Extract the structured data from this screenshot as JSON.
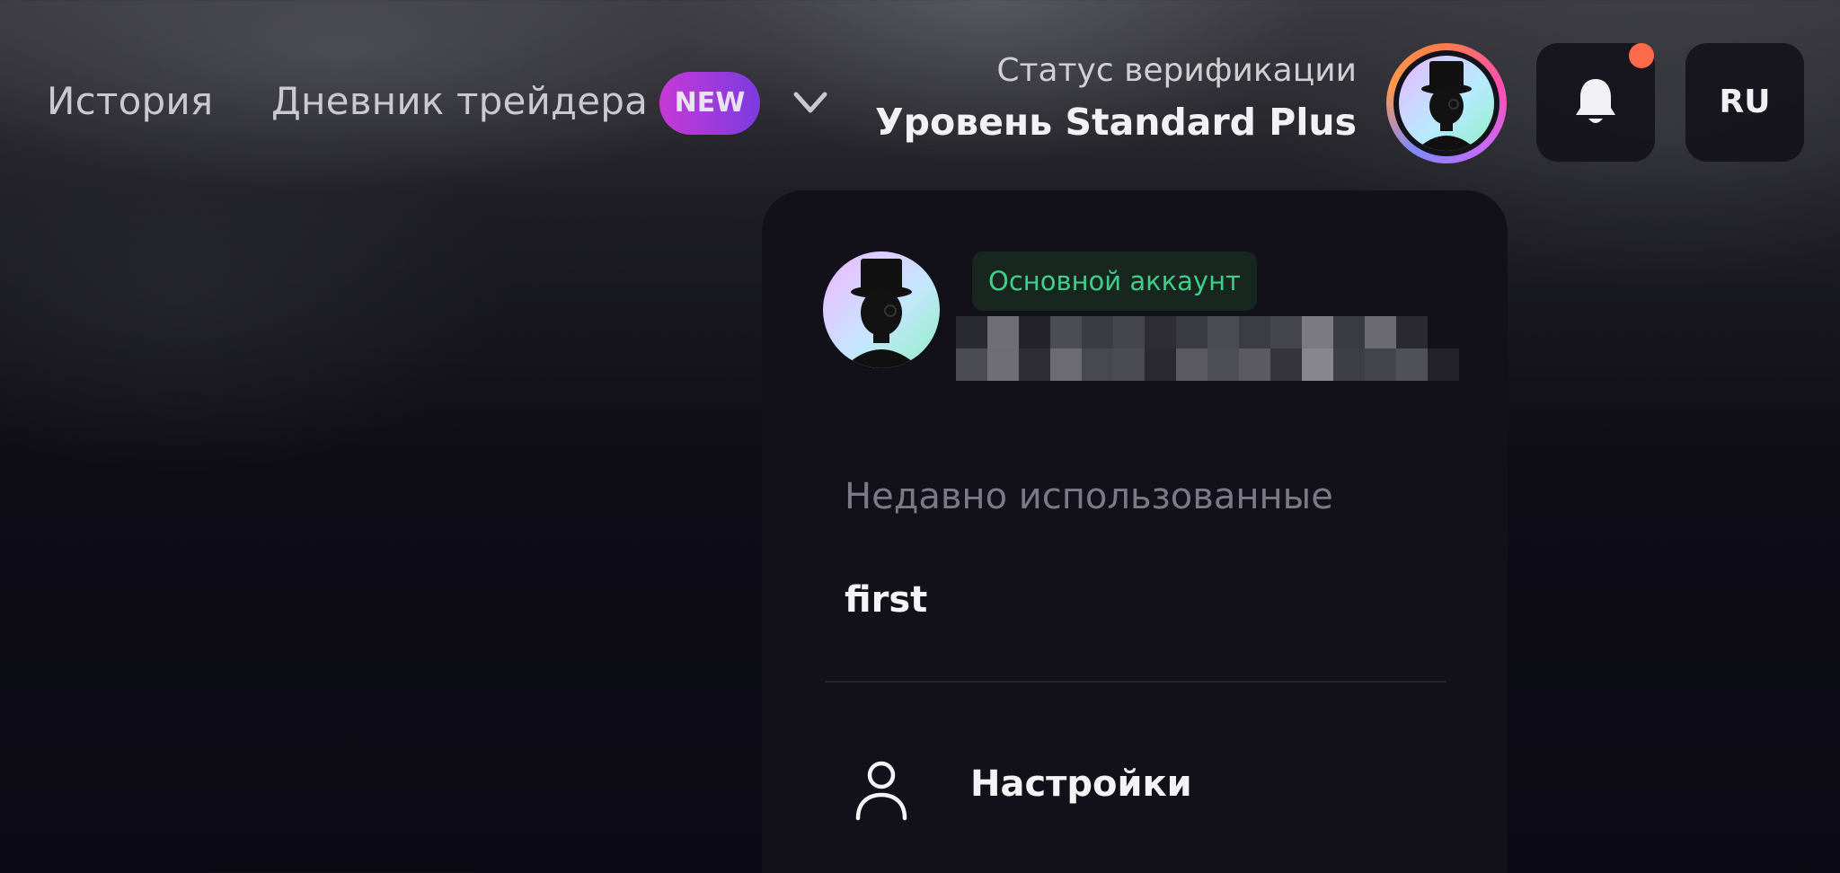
{
  "nav": {
    "history": "История",
    "diary": "Дневник трейдера",
    "new_badge": "NEW",
    "dropdown_icon": "chevron-down-icon"
  },
  "verification": {
    "title": "Статус верификации",
    "level": "Уровень Standard Plus"
  },
  "header": {
    "avatar_icon": "top-hat-avatar-icon",
    "bell_icon": "bell-icon",
    "has_notification": true,
    "notification_color": "#ff6a4a",
    "language": "RU"
  },
  "account_menu": {
    "account_badge": "Основной аккаунт",
    "account_badge_color": "#3ed08a",
    "account_id_obscured": true,
    "recent_label": "Недавно использованные",
    "recent_items": [
      "first"
    ],
    "settings_label": "Настройки",
    "settings_icon": "user-icon"
  },
  "colors": {
    "new_badge_start": "#c63ad6",
    "new_badge_end": "#7b3be0",
    "panel_bg": "#121119"
  }
}
